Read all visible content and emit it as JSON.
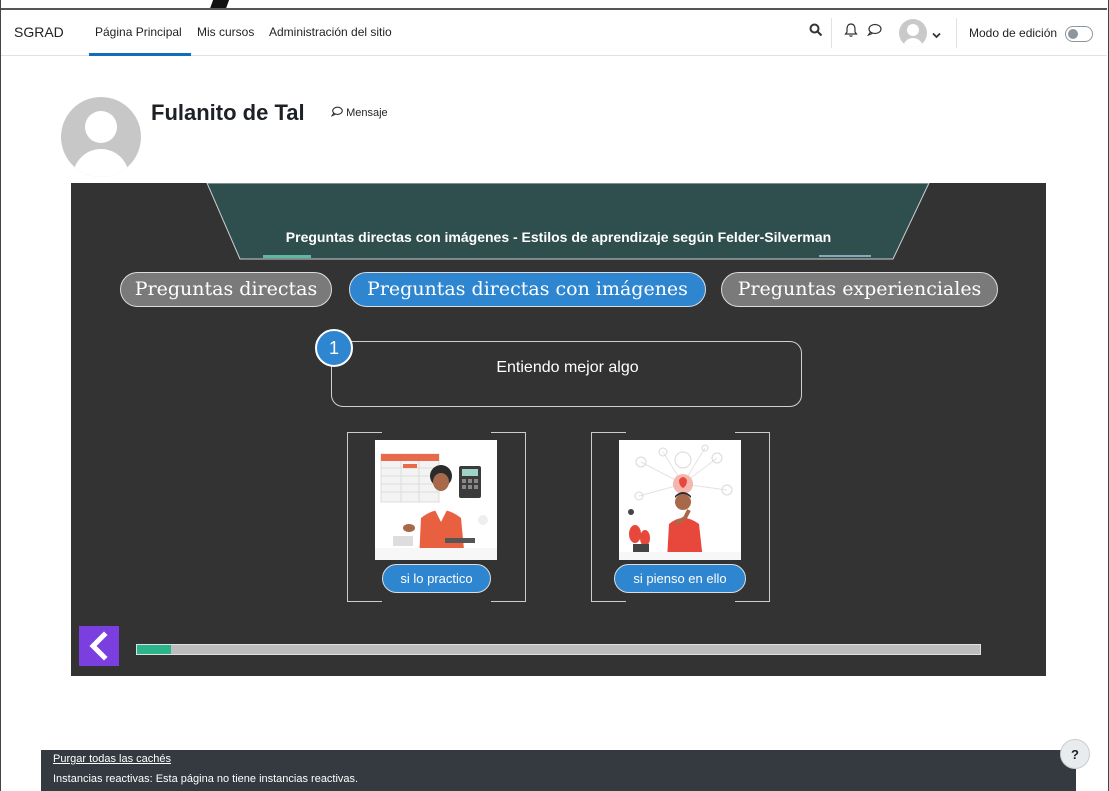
{
  "navbar": {
    "brand": "SGRAD",
    "items": [
      {
        "label": "Página Principal",
        "active": true
      },
      {
        "label": "Mis cursos",
        "active": false
      },
      {
        "label": "Administración del sitio",
        "active": false
      }
    ],
    "icons": [
      "search-icon",
      "bell-icon",
      "chat-icon",
      "user-avatar",
      "chevron-down-icon"
    ],
    "edit_mode_label": "Modo de edición",
    "edit_mode_on": false,
    "accent": "#0f6cbf"
  },
  "profile": {
    "name": "Fulanito de Tal",
    "message_label": "Mensaje"
  },
  "activity": {
    "title": "Preguntas directas con imágenes - Estilos de aprendizaje según Felder-Silverman",
    "tabs": [
      {
        "label": "Preguntas directas",
        "selected": false
      },
      {
        "label": "Preguntas directas con imágenes",
        "selected": true
      },
      {
        "label": "Preguntas experienciales",
        "selected": false
      }
    ],
    "question_number": "1",
    "question_text": "Entiendo mejor algo",
    "options": [
      {
        "label": "si lo practico",
        "image": "woman-calculator-illustration"
      },
      {
        "label": "si pienso en ello",
        "image": "man-thinking-illustration"
      }
    ],
    "back_icon": "chevron-left-icon",
    "progress_fraction": 0.04,
    "colors": {
      "panel": "#333333",
      "tab_selected": "#2e86d0",
      "tab_unselected": "#7a7a7a",
      "back_button": "#7b3fe0",
      "progress": "#2bb58a",
      "banner": "#2f4f4f"
    }
  },
  "footer": {
    "purge_link": "Purgar todas las cachés",
    "reactive_text": "Instancias reactivas: Esta página no tiene instancias reactivas."
  },
  "help_label": "?"
}
